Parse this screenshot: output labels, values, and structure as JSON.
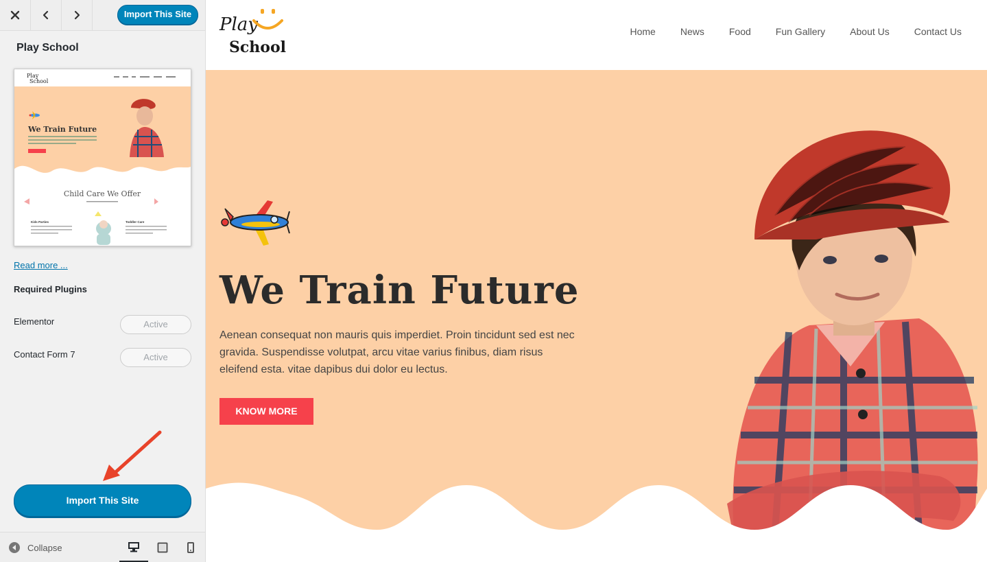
{
  "sidebar": {
    "import_top_label": "Import This Site",
    "site_title": "Play School",
    "thumbnail": {
      "hero_title": "We Train Future",
      "section_title": "Child Care We Offer",
      "card1": "Kids Parties",
      "card2": "Toddler Care"
    },
    "read_more": "Read more ...",
    "required_plugins_heading": "Required Plugins",
    "plugins": [
      {
        "name": "Elementor",
        "status": "Active"
      },
      {
        "name": "Contact Form 7",
        "status": "Active"
      }
    ],
    "import_main_label": "Import This Site",
    "collapse_label": "Collapse"
  },
  "preview": {
    "logo_line1": "Play",
    "logo_line2": "School",
    "nav": [
      "Home",
      "News",
      "Food",
      "Fun Gallery",
      "About Us",
      "Contact Us"
    ],
    "hero": {
      "title": "We Train Future",
      "text": "Aenean consequat non mauris quis imperdiet. Proin tincidunt sed est nec gravida. Suspendisse volutpat, arcu vitae varius finibus, diam risus eleifend esta. vitae dapibus dui dolor eu lectus.",
      "button_label": "KNOW MORE"
    }
  },
  "colors": {
    "primary_blue": "#0085ba",
    "hero_bg": "#fdd0a6",
    "cta_red": "#f6414b",
    "accent_orange": "#f5a623"
  },
  "icons": [
    "close-icon",
    "chevron-left-icon",
    "chevron-right-icon",
    "collapse-icon",
    "desktop-icon",
    "tablet-icon",
    "mobile-icon",
    "airplane-icon",
    "arrow-icon"
  ]
}
